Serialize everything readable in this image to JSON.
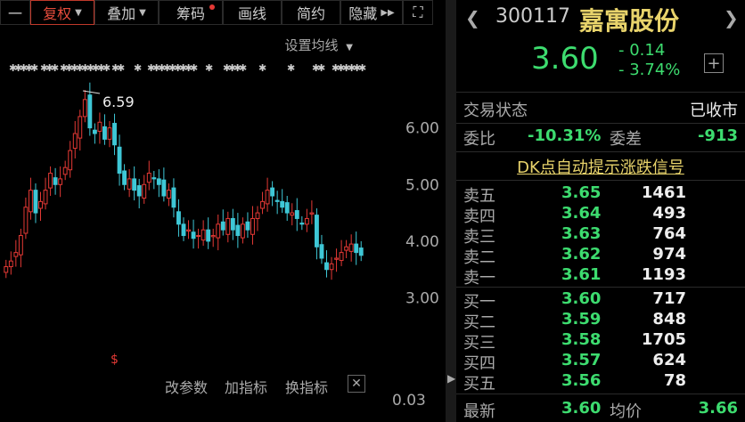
{
  "toolbar": {
    "menu": "一",
    "fuquan": "复权",
    "diejia": "叠加",
    "chouma": "筹码",
    "huaxian": "画线",
    "jianyue": "简约",
    "yincang": "隐藏"
  },
  "set_ma": "设置均线",
  "chart_data": {
    "type": "candlestick",
    "annotation": "6.59",
    "y_ticks": [
      "6.00",
      "5.00",
      "4.00",
      "3.00"
    ],
    "volume_tick": "0.03",
    "ylim": [
      2.6,
      7.0
    ],
    "closes": [
      3.55,
      3.65,
      3.8,
      4.1,
      4.6,
      4.9,
      4.5,
      4.7,
      4.9,
      5.2,
      5.0,
      5.1,
      5.3,
      5.6,
      5.9,
      6.2,
      6.5,
      6.0,
      5.9,
      6.1,
      5.8,
      6.0,
      5.7,
      5.2,
      5.0,
      5.1,
      4.9,
      4.8,
      5.0,
      5.2,
      5.1,
      5.0,
      4.8,
      4.9,
      4.6,
      4.3,
      4.1,
      4.2,
      4.05,
      4.1,
      4.2,
      4.0,
      4.1,
      4.3,
      4.2,
      4.4,
      4.2,
      4.1,
      4.3,
      4.2,
      4.4,
      4.5,
      4.7,
      4.9,
      4.8,
      4.7,
      4.6,
      4.5,
      4.5,
      4.4,
      4.3,
      4.4,
      4.5,
      3.9,
      3.7,
      3.5,
      3.6,
      3.7,
      3.8,
      3.9,
      3.95,
      3.8,
      3.75
    ]
  },
  "bottombar": {
    "gaicanshu": "改参数",
    "jiazhibiao": "加指标",
    "huanzhibiao": "换指标",
    "close": "✕"
  },
  "quote": {
    "code": "300117",
    "name": "嘉寓股份",
    "price": "3.60",
    "change": "- 0.14",
    "change_pct": "- 3.74%",
    "status_label": "交易状态",
    "status_value": "已收市",
    "weibi_label": "委比",
    "weibi_value": "-10.31%",
    "weicha_label": "委差",
    "weicha_value": "-913",
    "signal": "DK点自动提示涨跌信号",
    "asks": [
      {
        "name": "卖五",
        "price": "3.65",
        "vol": "1461"
      },
      {
        "name": "卖四",
        "price": "3.64",
        "vol": "493"
      },
      {
        "name": "卖三",
        "price": "3.63",
        "vol": "764"
      },
      {
        "name": "卖二",
        "price": "3.62",
        "vol": "974"
      },
      {
        "name": "卖一",
        "price": "3.61",
        "vol": "1193"
      }
    ],
    "bids": [
      {
        "name": "买一",
        "price": "3.60",
        "vol": "717"
      },
      {
        "name": "买二",
        "price": "3.59",
        "vol": "848"
      },
      {
        "name": "买三",
        "price": "3.58",
        "vol": "1705"
      },
      {
        "name": "买四",
        "price": "3.57",
        "vol": "624"
      },
      {
        "name": "买五",
        "price": "3.56",
        "vol": "78"
      }
    ],
    "latest_label": "最新",
    "latest_value": "3.60",
    "avg_label": "均价",
    "avg_value": "3.66"
  },
  "colors": {
    "up": "#e53935",
    "down": "#3ddc6f",
    "candle_down": "#3ec7d6"
  }
}
